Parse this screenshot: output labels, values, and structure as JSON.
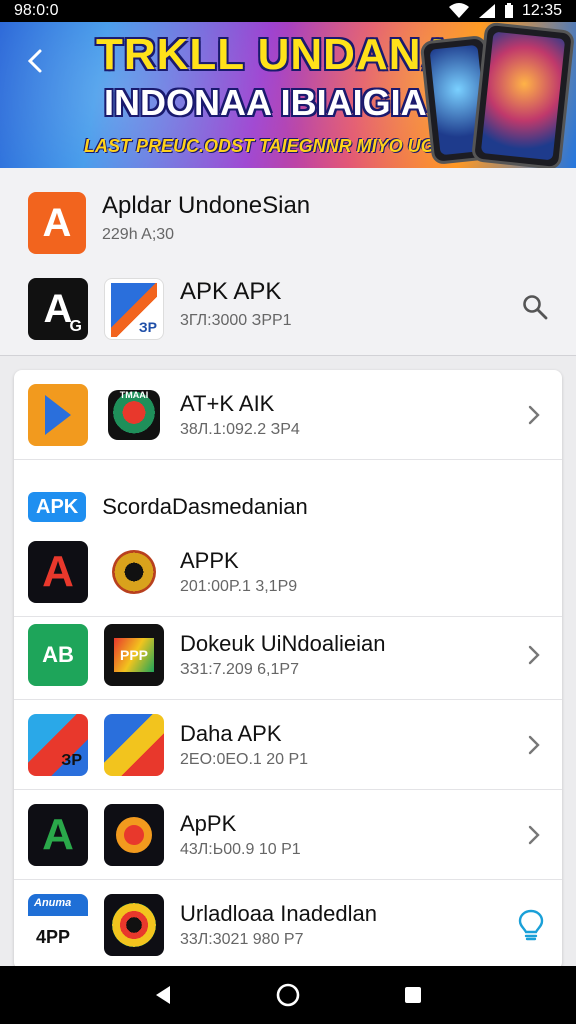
{
  "status_bar": {
    "left_text": "98:0:0",
    "time": "12:35"
  },
  "banner": {
    "line1": "TRKLL UNDANA",
    "line2": "INDONAA IBIAIGIA",
    "line3": "LAST PREUC.ODST TAIEGNNR MIYO UGO REOTO"
  },
  "header_apps": {
    "app1": {
      "icon_text": "A",
      "title": "Apldar UndoneSian",
      "meta": "229h A;30"
    },
    "app2": {
      "icon_a_text": "A",
      "icon_a_sub": "G",
      "icon_b_text": "ЗР",
      "title": "APK  APK",
      "meta": "3ГЛ:3000 ЗРР1"
    }
  },
  "list": {
    "top_item": {
      "icon_b_text": "TMAAI",
      "title": "AT+K AIK",
      "meta": "38Л.1:092.2 ЗР4"
    },
    "section_badge": "APK",
    "section_title": "ScordaDasmedanian",
    "items": [
      {
        "title": "APPK",
        "meta": "201:00P.1 3,1Р9",
        "icon_a_text": "A",
        "has_chevron": false
      },
      {
        "title": "Dokeuk UiNdoalieian",
        "meta": "ЗЗ1:7.209 6,1Р7",
        "icon_a_text": "AB",
        "icon_b_text": "PPP",
        "has_chevron": true
      },
      {
        "title": "Daha APK",
        "meta": "2ЕО:0ЕО.1 20 Р1",
        "icon_a_text": "ЗР",
        "has_chevron": true
      },
      {
        "title": "ApPK",
        "meta": "43Л:Ь00.9 10 Р1",
        "icon_a_text": "A",
        "has_chevron": true
      },
      {
        "title": "Urladloaa  Inadedlan",
        "meta": "33Л:3021 980 Р7",
        "icon_a_text": "4PP",
        "icon_a_top": "Anuma",
        "has_chevron": false
      }
    ]
  },
  "colors": {
    "accent": "#1f8ff0",
    "orange": "#f2641e",
    "banner_yellow": "#ffe21a"
  },
  "icons": {
    "back": "back-arrow-icon",
    "search": "search-icon",
    "chevron": "chevron-right-icon",
    "bulb": "lightbulb-icon",
    "nav_back": "triangle-back-icon",
    "nav_home": "circle-home-icon",
    "nav_recent": "square-recent-icon"
  }
}
